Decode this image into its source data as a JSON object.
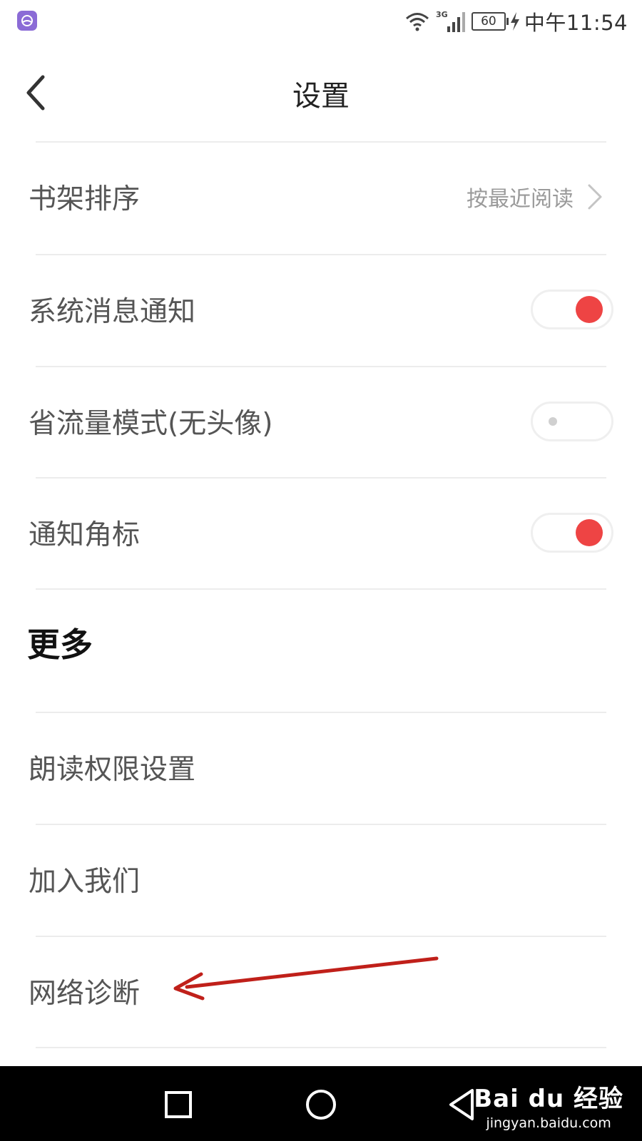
{
  "status_bar": {
    "time": "中午11:54",
    "battery": "60",
    "network": "3G"
  },
  "header": {
    "title": "设置"
  },
  "rows": [
    {
      "label": "书架排序",
      "value": "按最近阅读",
      "type": "link"
    },
    {
      "label": "系统消息通知",
      "type": "toggle",
      "on": true
    },
    {
      "label": "省流量模式(无头像)",
      "type": "toggle",
      "on": false
    },
    {
      "label": "通知角标",
      "type": "toggle",
      "on": true
    }
  ],
  "more_section": {
    "title": "更多",
    "items": [
      {
        "label": "朗读权限设置"
      },
      {
        "label": "加入我们"
      },
      {
        "label": "网络诊断"
      }
    ]
  },
  "watermark": {
    "logo": "Bai du 经验",
    "url": "jingyan.baidu.com"
  },
  "colors": {
    "accent": "#ee4444",
    "annotation": "#c0201a"
  }
}
